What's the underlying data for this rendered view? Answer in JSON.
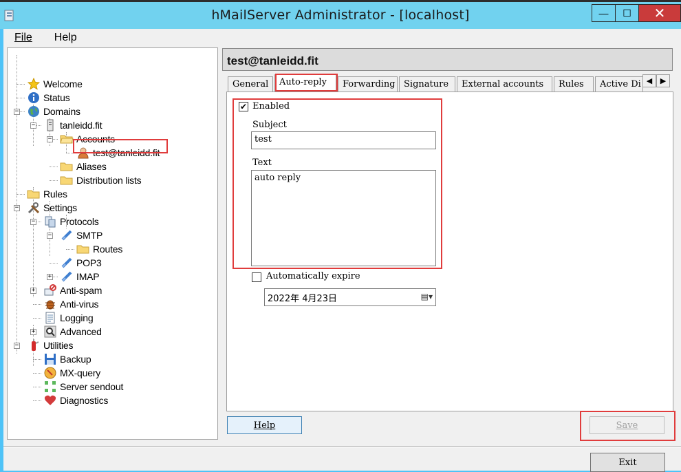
{
  "window": {
    "title": "hMailServer Administrator - [localhost]",
    "minimize_glyph": "—",
    "maximize_glyph": "☐",
    "close_glyph": "✕"
  },
  "menu": {
    "file": "File",
    "help": "Help"
  },
  "tree": {
    "welcome": "Welcome",
    "status": "Status",
    "domains": "Domains",
    "domain": "tanleidd.fit",
    "accounts": "Accounts",
    "account": "test@tanleidd.fit",
    "aliases": "Aliases",
    "distribution_lists": "Distribution lists",
    "rules": "Rules",
    "settings": "Settings",
    "protocols": "Protocols",
    "smtp": "SMTP",
    "routes": "Routes",
    "pop3": "POP3",
    "imap": "IMAP",
    "anti_spam": "Anti-spam",
    "anti_virus": "Anti-virus",
    "logging": "Logging",
    "advanced": "Advanced",
    "utilities": "Utilities",
    "backup": "Backup",
    "mx_query": "MX-query",
    "server_sendout": "Server sendout",
    "diagnostics": "Diagnostics"
  },
  "header": {
    "title": "test@tanleidd.fit"
  },
  "tabs": [
    "General",
    "Auto-reply",
    "Forwarding",
    "Signature",
    "External accounts",
    "Rules",
    "Active Di"
  ],
  "active_tab": "Auto-reply",
  "autoreply": {
    "enabled_label": "Enabled",
    "enabled": true,
    "subject_label": "Subject",
    "subject_value": "test",
    "text_label": "Text",
    "text_value": "auto reply",
    "expire_label": "Automatically expire",
    "expire_checked": false,
    "expire_date": "2022年  4月23日"
  },
  "buttons": {
    "help": "Help",
    "save": "Save",
    "exit": "Exit"
  },
  "colors": {
    "highlight": "#e03c3c",
    "titlebar": "#71d2ef",
    "close": "#c93b3b"
  }
}
